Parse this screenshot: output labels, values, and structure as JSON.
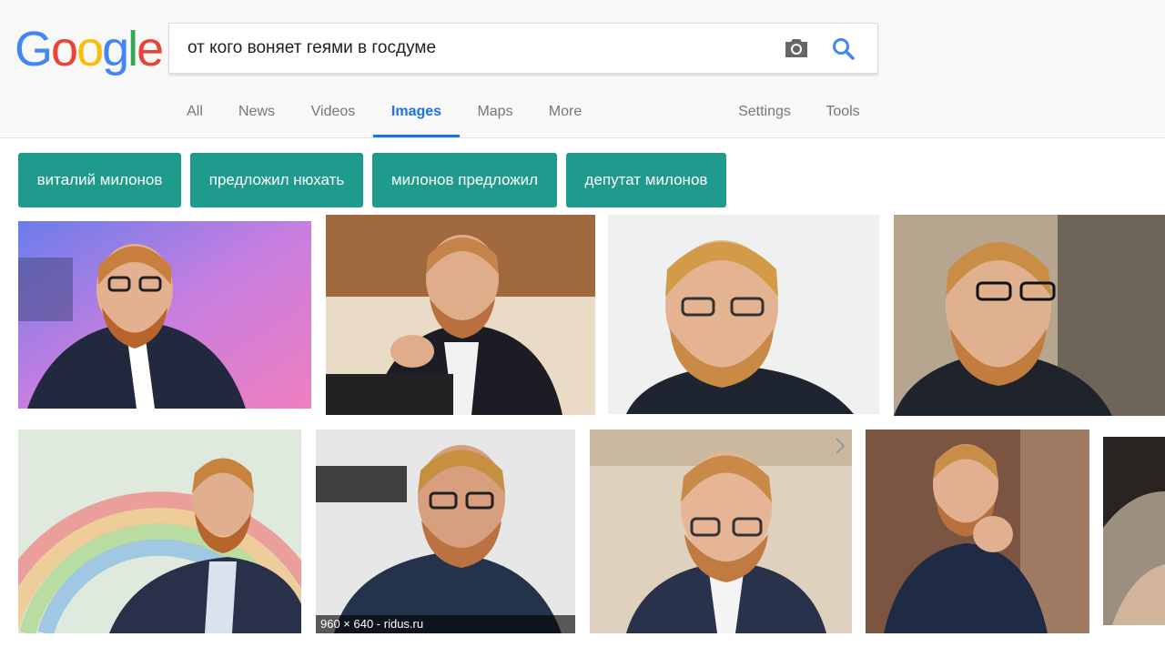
{
  "logo": {
    "letters": [
      "G",
      "o",
      "o",
      "g",
      "l",
      "e"
    ],
    "colors": [
      "#4285f4",
      "#ea4335",
      "#fbbc05",
      "#4285f4",
      "#34a853",
      "#ea4335"
    ]
  },
  "search": {
    "query": "от кого воняет геями в госдуме",
    "camera_icon": "camera-icon",
    "search_icon": "search-icon"
  },
  "tabs": [
    {
      "label": "All"
    },
    {
      "label": "News"
    },
    {
      "label": "Videos"
    },
    {
      "label": "Images",
      "active": true
    },
    {
      "label": "Maps"
    },
    {
      "label": "More"
    },
    {
      "label": "Settings"
    },
    {
      "label": "Tools"
    }
  ],
  "chips": [
    "виталий милонов",
    "предложил нюхать",
    "милонов предложил",
    "депутат милонов"
  ],
  "colors": {
    "accent": "#1a73e8",
    "chip": "#1e9b8c"
  },
  "results": {
    "hovered_caption": "960 × 640 - ridus.ru"
  }
}
